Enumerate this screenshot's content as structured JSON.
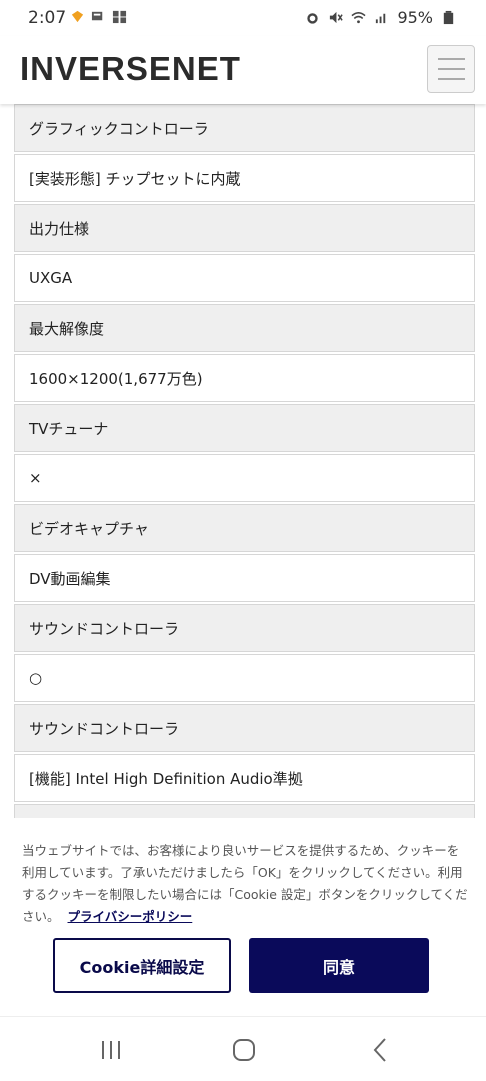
{
  "status_bar": {
    "time": "2:07",
    "battery": "95%",
    "icons": [
      "heart-icon",
      "notification-icon",
      "alarm-icon",
      "mute-icon",
      "wifi-icon",
      "signal-icon",
      "battery-icon"
    ]
  },
  "header": {
    "logo": "INVERSENET",
    "menu_icon": "hamburger-menu-icon"
  },
  "spec_rows": [
    {
      "type": "head",
      "text": "グラフィックコントローラ"
    },
    {
      "type": "val",
      "text": "[実装形態] チップセットに内蔵"
    },
    {
      "type": "head",
      "text": "出力仕様"
    },
    {
      "type": "val",
      "text": "UXGA"
    },
    {
      "type": "head",
      "text": "最大解像度"
    },
    {
      "type": "val",
      "text": "1600×1200(1,677万色)"
    },
    {
      "type": "head",
      "text": "TVチューナ"
    },
    {
      "type": "val",
      "text": "×"
    },
    {
      "type": "head",
      "text": "ビデオキャプチャ"
    },
    {
      "type": "val",
      "text": "DV動画編集"
    },
    {
      "type": "head",
      "text": "サウンドコントローラ"
    },
    {
      "type": "val",
      "text": "○"
    },
    {
      "type": "head",
      "text": "サウンドコントローラ"
    },
    {
      "type": "val",
      "text": "[機能] Intel High Definition Audio準拠"
    },
    {
      "type": "head",
      "text": ""
    }
  ],
  "cookie": {
    "message": "当ウェブサイトでは、お客様により良いサービスを提供するため、クッキーを利用しています。了承いただけましたら「OK」をクリックしてください。利用するクッキーを制限したい場合には「Cookie 設定」ボタンをクリックしてください。",
    "policy_link": "プライバシーポリシー",
    "settings_button": "Cookie詳細設定",
    "agree_button": "同意"
  },
  "colors": {
    "brand_navy": "#0a0a5a",
    "row_header_bg": "#efefef"
  }
}
